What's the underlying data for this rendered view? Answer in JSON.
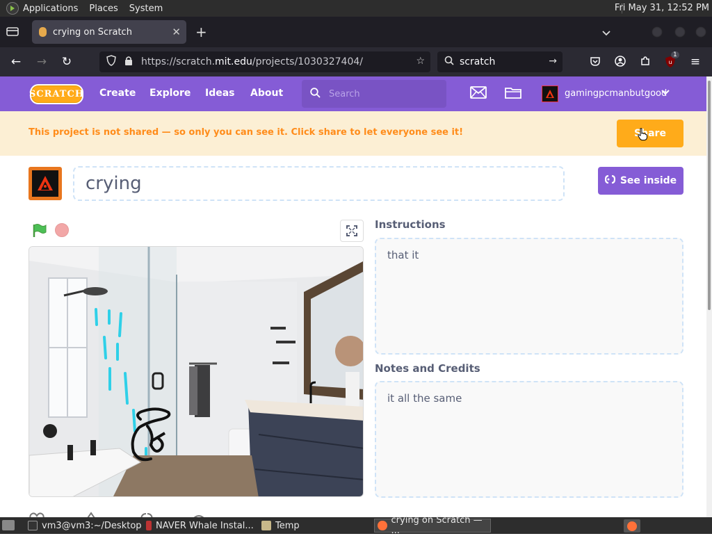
{
  "system_panel": {
    "menu": [
      "Applications",
      "Places",
      "System"
    ],
    "clock": "Fri May 31, 12:52 PM"
  },
  "browser": {
    "tab_title": "crying on Scratch",
    "url_prefix": "https://scratch.",
    "url_domain": "mit.edu",
    "url_path": "/projects/1030327404/",
    "search_query": "scratch",
    "extension_badge": "1"
  },
  "scratch_nav": {
    "logo": "SCRATCH",
    "links": [
      "Create",
      "Explore",
      "Ideas",
      "About"
    ],
    "search_placeholder": "Search",
    "username": "gamingpcmanbutgood"
  },
  "banner": {
    "message": "This project is not shared — so only you can see it. Click share to let everyone see it!",
    "share_label": "Share"
  },
  "project": {
    "title": "crying",
    "see_inside_label": "See inside",
    "instructions_heading": "Instructions",
    "instructions": "that it",
    "notes_heading": "Notes and Credits",
    "notes": "it all the same"
  },
  "taskbar": {
    "items": [
      "vm3@vm3:~/Desktop",
      "NAVER Whale Instal...",
      "Temp",
      "crying on Scratch — ..."
    ]
  },
  "colors": {
    "scratch_purple": "#855cd6",
    "share_orange": "#ffab1a",
    "banner_bg": "#fcefd4",
    "banner_text": "#ff8c1a"
  }
}
